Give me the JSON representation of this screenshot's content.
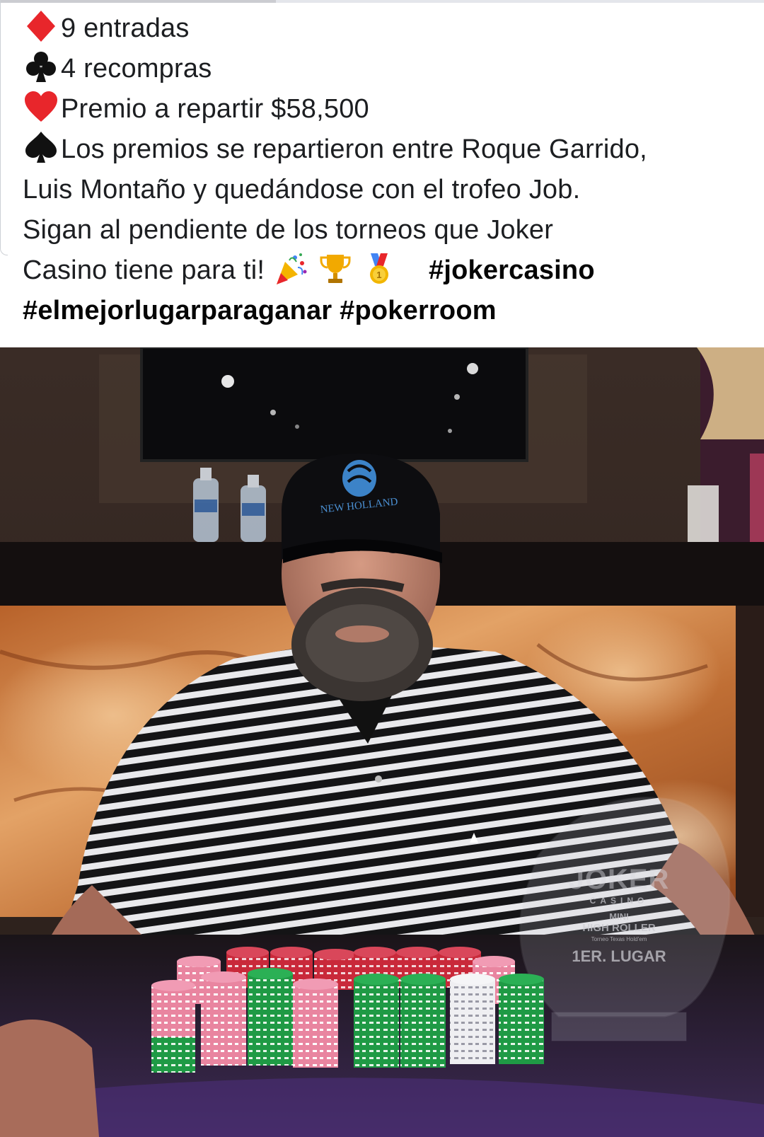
{
  "post": {
    "lines": [
      {
        "icon": "diamond-suit-icon",
        "text": "9 entradas"
      },
      {
        "icon": "club-suit-icon",
        "text": "4 recompras"
      },
      {
        "icon": "heart-suit-icon",
        "text": "Premio a repartir $58,500"
      },
      {
        "icon": "spade-suit-icon",
        "text": "Los premios se repartieron entre Roque Garrido,"
      }
    ],
    "line5": "Luis Montaño y quedándose con el trofeo Job.",
    "line6": "Sigan al pendiente de los torneos que Joker",
    "line7": "Casino tiene para ti!",
    "emojis": [
      "party-popper-icon",
      "trophy-icon",
      "first-place-medal-icon"
    ],
    "hashtags": [
      "#jokercasino",
      "#elmejorlugarparaganar",
      "#pokerroom"
    ]
  },
  "photo": {
    "cap_text": "NEW HOLLAND",
    "trophy": {
      "brand": "JOKER",
      "brand_sub": "CASINO",
      "line1": "MINI",
      "line2": "HIGH ROLLER",
      "line3": "Torneo Texas Hold'em",
      "place": "1ER. LUGAR"
    }
  },
  "colors": {
    "diamond": "#e8262b",
    "heart": "#e8262b",
    "club": "#111111",
    "spade": "#111111",
    "text": "#1c1e21"
  }
}
